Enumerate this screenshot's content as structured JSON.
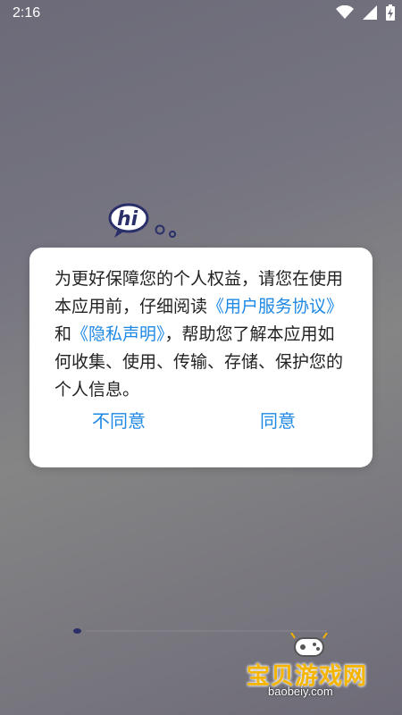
{
  "status_bar": {
    "time": "2:16",
    "icons": [
      "wifi-icon",
      "cell-signal-icon",
      "battery-charging-icon"
    ]
  },
  "logo": {
    "text": "hi"
  },
  "dialog": {
    "text_before": "为更好保障您的个人权益，请您在使用本应用前，仔细阅读",
    "link_terms": "《用户服务协议》",
    "text_and": "和",
    "link_privacy": "《隐私声明》",
    "text_after": "，帮助您了解本应用如何收集、使用、传输、存储、保护您的个人信息。",
    "disagree_label": "不同意",
    "agree_label": "同意"
  },
  "watermark": {
    "name": "宝贝游戏网",
    "url": "baobeiy.com"
  },
  "colors": {
    "link": "#1e88e5",
    "watermark": "#f4b400",
    "logo": "#2a2f6a"
  }
}
